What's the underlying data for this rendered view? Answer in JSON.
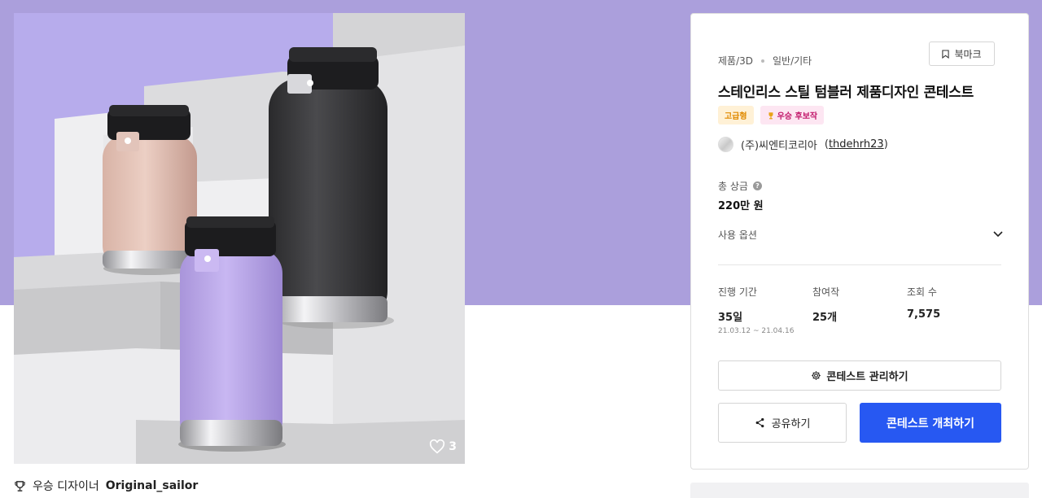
{
  "product": {
    "likes": "3",
    "winner_label": "우승 디자이너",
    "winner_name": "Original_sailor"
  },
  "contest": {
    "category": "제품/3D",
    "subcategory": "일반/기타",
    "bookmark_label": "북마크",
    "title": "스테인리스 스틸 텀블러 제품디자인 콘테스트",
    "badges": {
      "grade": "고급형",
      "winner": "우승 후보작"
    },
    "host_name": "(주)씨엔티코리아",
    "host_id": "thdehrh23",
    "prize_label": "총 상금",
    "prize_value": "220만 원",
    "options_label": "사용 옵션",
    "stats": {
      "period_label": "진행 기간",
      "period_value": "35일",
      "period_range": "21.03.12 ~ 21.04.16",
      "participants_label": "참여작",
      "participants_value": "25개",
      "views_label": "조회 수",
      "views_value": "7,575"
    },
    "manage_label": "콘테스트 관리하기",
    "share_label": "공유하기",
    "host_contest_label": "콘테스트 개최하기"
  },
  "colors": {
    "hero_band": "#ab9fdc",
    "primary_button": "#2758f2",
    "grade_badge": "#e08a00",
    "winner_badge": "#c2186b"
  }
}
